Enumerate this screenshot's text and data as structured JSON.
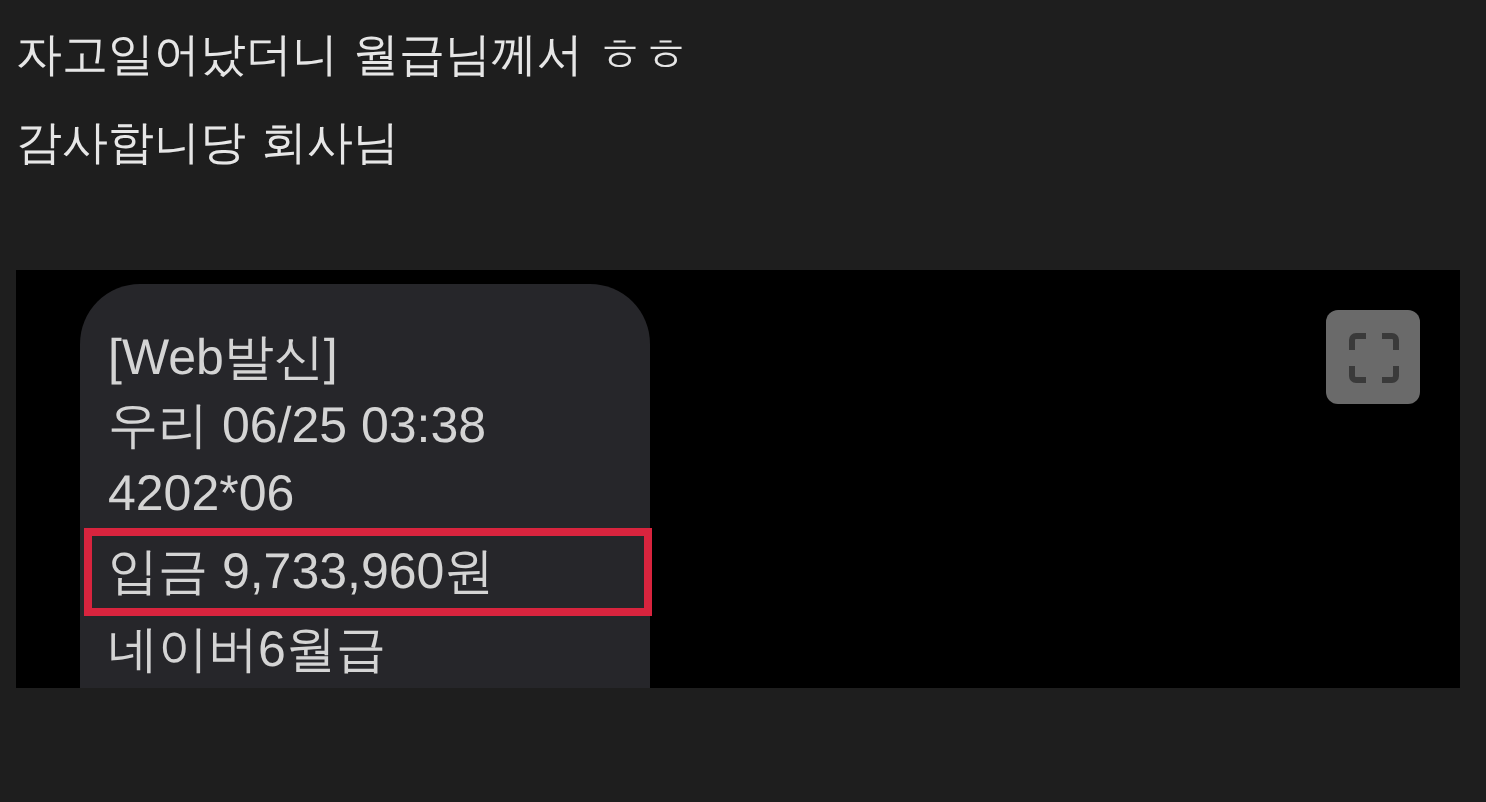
{
  "post": {
    "lines": [
      "자고일어났더니 월급님께서 ㅎㅎ",
      "감사합니당 회사님"
    ]
  },
  "image": {
    "message_lines": [
      {
        "text": "[Web발신]",
        "highlighted": false
      },
      {
        "text": "우리 06/25 03:38",
        "highlighted": false
      },
      {
        "text": "4202*06",
        "highlighted": false
      },
      {
        "text": "입금 9,733,960원",
        "highlighted": true
      },
      {
        "text": "네이버6월급",
        "highlighted": false
      }
    ],
    "expand_button": true
  }
}
